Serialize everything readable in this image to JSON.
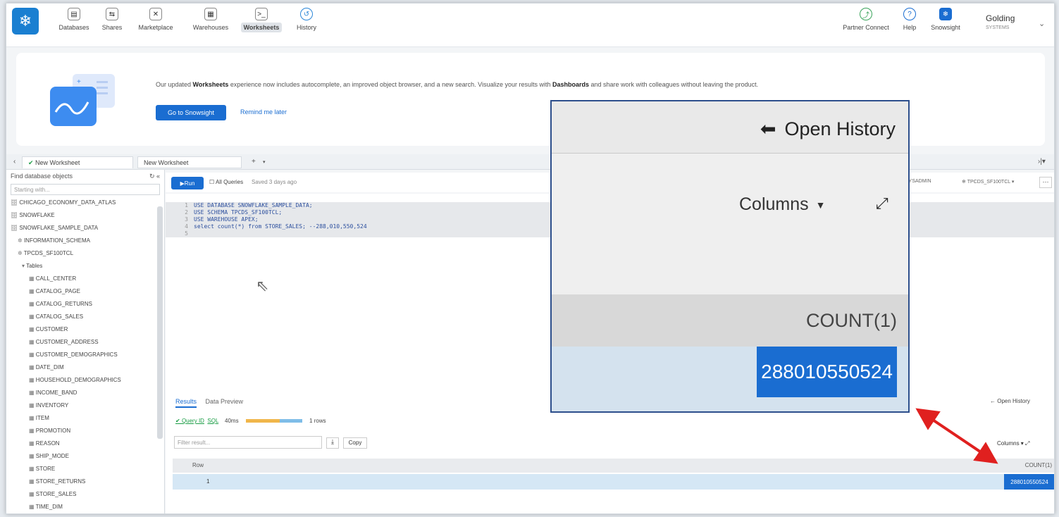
{
  "nav": {
    "items": [
      {
        "label": "Databases",
        "icon": "database-icon"
      },
      {
        "label": "Shares",
        "icon": "shares-icon"
      },
      {
        "label": "Marketplace",
        "icon": "marketplace-icon"
      },
      {
        "label": "Warehouses",
        "icon": "warehouse-icon"
      },
      {
        "label": "Worksheets",
        "icon": "terminal-icon"
      },
      {
        "label": "History",
        "icon": "history-icon"
      }
    ],
    "right_items": [
      {
        "label": "Partner Connect",
        "icon": "partner-connect-icon"
      },
      {
        "label": "Help",
        "icon": "help-icon"
      },
      {
        "label": "Snowsight",
        "icon": "snowsight-icon"
      }
    ],
    "user_name": "Golding",
    "user_role": "SYSTEMS"
  },
  "banner": {
    "text_pre": "Our updated ",
    "text_bold1": "Worksheets",
    "text_mid": " experience now includes autocomplete, an improved object browser, and a new search. Visualize your results with ",
    "text_bold2": "Dashboards",
    "text_post": " and share work with colleagues without leaving the product.",
    "primary_button": "Go to Snowsight",
    "secondary_link": "Remind me later"
  },
  "tabs": {
    "tab1": "New Worksheet",
    "tab2": "New Worksheet"
  },
  "left_panel": {
    "heading": "Find database objects",
    "search_placeholder": "Starting with...",
    "tree": [
      "CHICAGO_ECONOMY_DATA_ATLAS",
      "SNOWFLAKE",
      "SNOWFLAKE_SAMPLE_DATA",
      "INFORMATION_SCHEMA",
      "TPCDS_SF100TCL",
      "Tables",
      "CALL_CENTER",
      "CATALOG_PAGE",
      "CATALOG_RETURNS",
      "CATALOG_SALES",
      "CUSTOMER",
      "CUSTOMER_ADDRESS",
      "CUSTOMER_DEMOGRAPHICS",
      "DATE_DIM",
      "HOUSEHOLD_DEMOGRAPHICS",
      "INCOME_BAND",
      "INVENTORY",
      "ITEM",
      "PROMOTION",
      "REASON",
      "SHIP_MODE",
      "STORE",
      "STORE_RETURNS",
      "STORE_SALES",
      "TIME_DIM"
    ]
  },
  "editor": {
    "run_label": "Run",
    "all_queries": "All Queries",
    "saved": "Saved 3 days ago",
    "context_role": "SYSADMIN",
    "context_db": "TPCDS_SF100TCL",
    "lines": [
      "USE DATABASE SNOWFLAKE_SAMPLE_DATA;",
      "USE SCHEMA TPCDS_SF100TCL;",
      "USE WAREHOUSE APEX;",
      "select count(*) from STORE_SALES; --288,010,550,524",
      ""
    ]
  },
  "results": {
    "tab_results": "Results",
    "tab_preview": "Data Preview",
    "open_history": "Open History",
    "query_id": "Query ID",
    "sql": "SQL",
    "duration": "40ms",
    "rows": "1 rows",
    "filter_placeholder": "Filter result...",
    "copy": "Copy",
    "columns": "Columns",
    "header_row": "Row",
    "header_col": "COUNT(1)",
    "row_num": "1",
    "row_val": "288010550524"
  },
  "zoom": {
    "open_history": "Open History",
    "columns": "Columns",
    "header": "COUNT(1)",
    "value": "288010550524"
  },
  "colors": {
    "accent": "#1a6dd1",
    "zoom_border": "#2d4f8c",
    "arrow": "#e0201f"
  }
}
